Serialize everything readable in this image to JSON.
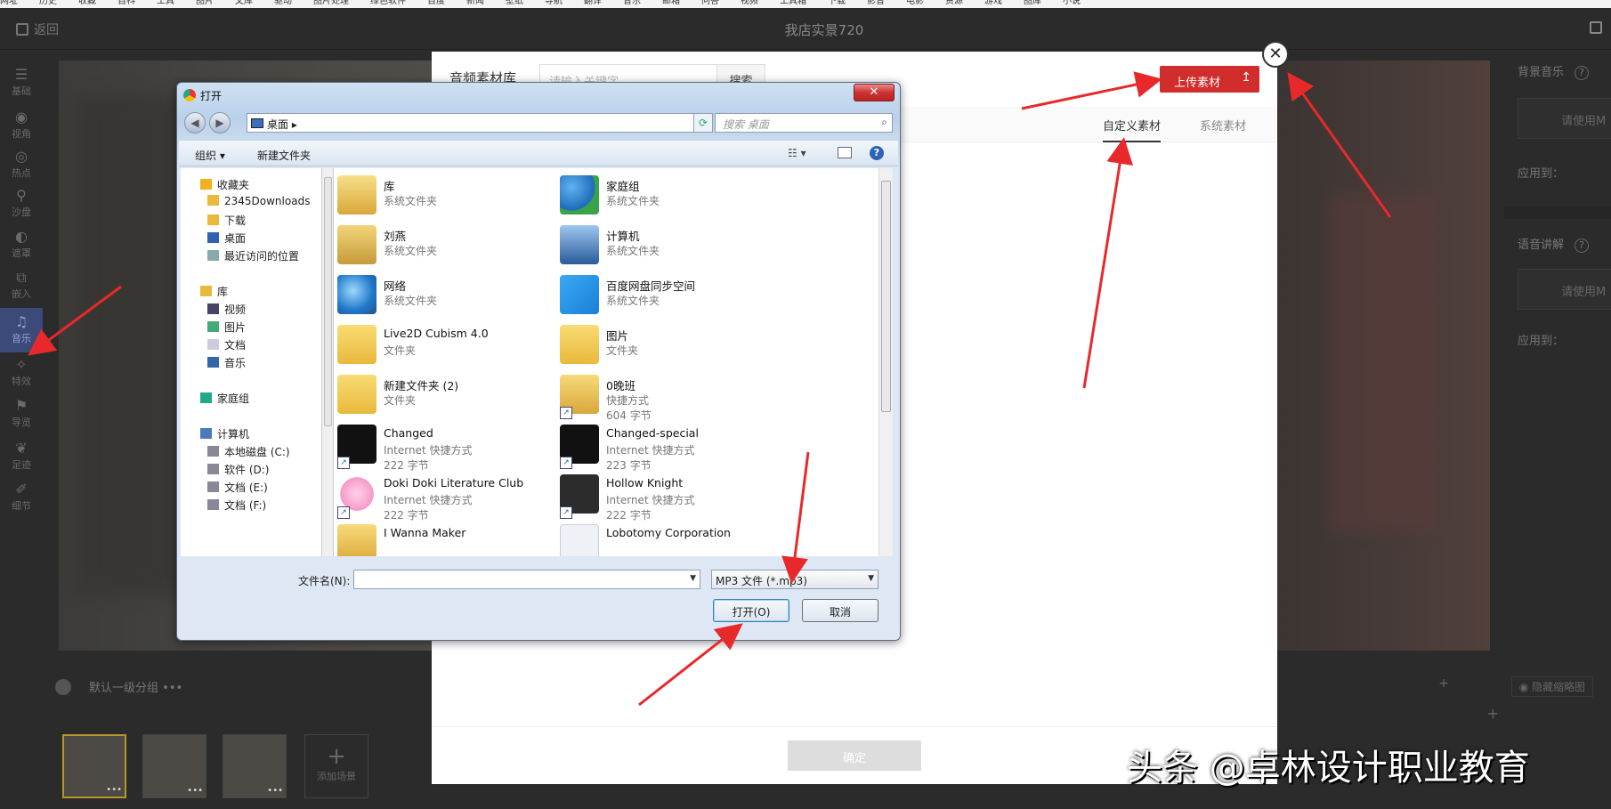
{
  "bookmarks": [
    "网址",
    "历史",
    "收藏",
    "百科",
    "工具",
    "图片",
    "文库",
    "驱动",
    "图片处理",
    "绿色软件",
    "百度",
    "新闻",
    "壁纸",
    "导航",
    "翻译",
    "音乐",
    "邮箱",
    "问答",
    "视频",
    "工具箱",
    "下载",
    "影音",
    "电影",
    "资源",
    "游戏",
    "图库",
    "小说"
  ],
  "app": {
    "back_label": "返回",
    "title": "我店实景720"
  },
  "rail": [
    {
      "icon": "list-icon",
      "glyph": "☰",
      "label": "基础"
    },
    {
      "icon": "eye-icon",
      "glyph": "◉",
      "label": "视角"
    },
    {
      "icon": "hotspot-icon",
      "glyph": "◎",
      "label": "热点"
    },
    {
      "icon": "pin-icon",
      "glyph": "⚲",
      "label": "沙盘"
    },
    {
      "icon": "mask-icon",
      "glyph": "◐",
      "label": "遮罩"
    },
    {
      "icon": "embed-icon",
      "glyph": "⧉",
      "label": "嵌入"
    },
    {
      "icon": "music-icon",
      "glyph": "♫",
      "label": "音乐"
    },
    {
      "icon": "effect-icon",
      "glyph": "✧",
      "label": "特效"
    },
    {
      "icon": "guide-icon",
      "glyph": "⚑",
      "label": "导览"
    },
    {
      "icon": "footprint-icon",
      "glyph": "❦",
      "label": "足迹"
    },
    {
      "icon": "detail-icon",
      "glyph": "✐",
      "label": "细节"
    }
  ],
  "right_panel": {
    "bg_music_title": "背景音乐",
    "bg_music_placeholder": "请使用M",
    "apply_to_1": "应用到：",
    "voice_title": "语音讲解",
    "voice_placeholder": "请使用M",
    "apply_to_2": "应用到：",
    "help_glyph": "?"
  },
  "bottom": {
    "group_label": "默认一级分组",
    "group_more": "•••",
    "add_scene_label": "添加场景",
    "hide_thumbs_label": "隐藏缩略图",
    "thumb_more": "•••"
  },
  "modal": {
    "title": "音频素材库",
    "search_placeholder": "请输入关键字",
    "search_button": "搜索",
    "upload_button": "上传素材",
    "tabs": [
      "自定义素材",
      "系统素材"
    ],
    "ok_button": "确定",
    "close_glyph": "✕"
  },
  "dialog": {
    "title": "打开",
    "address": "桌面",
    "address_arrow": "▸",
    "search_placeholder": "搜索 桌面",
    "toolbar": {
      "organize": "组织 ▾",
      "new_folder": "新建文件夹"
    },
    "nav": [
      {
        "label": "收藏夹",
        "level": 1,
        "icon": "star-icon",
        "color": "#f3b21b"
      },
      {
        "label": "2345Downloads",
        "level": 2,
        "icon": "folder-icon",
        "color": "#e8b93b"
      },
      {
        "label": "下载",
        "level": 2,
        "icon": "download-folder-icon",
        "color": "#e8b93b"
      },
      {
        "label": "桌面",
        "level": 2,
        "icon": "desktop-icon",
        "color": "#2f62b0"
      },
      {
        "label": "最近访问的位置",
        "level": 2,
        "icon": "recent-icon",
        "color": "#8aa"
      },
      {
        "label": "库",
        "level": 1,
        "icon": "library-icon",
        "color": "#e8b93b"
      },
      {
        "label": "视频",
        "level": 2,
        "icon": "video-icon",
        "color": "#446"
      },
      {
        "label": "图片",
        "level": 2,
        "icon": "pictures-icon",
        "color": "#4a7"
      },
      {
        "label": "文档",
        "level": 2,
        "icon": "document-icon",
        "color": "#ccd"
      },
      {
        "label": "音乐",
        "level": 2,
        "icon": "music-icon",
        "color": "#36a"
      },
      {
        "label": "家庭组",
        "level": 1,
        "icon": "homegroup-icon",
        "color": "#2a8"
      },
      {
        "label": "计算机",
        "level": 1,
        "icon": "computer-icon",
        "color": "#4a7bbf"
      },
      {
        "label": "本地磁盘 (C:)",
        "level": 2,
        "icon": "drive-icon",
        "color": "#889"
      },
      {
        "label": "软件 (D:)",
        "level": 2,
        "icon": "drive-icon",
        "color": "#889"
      },
      {
        "label": "文档 (E:)",
        "level": 2,
        "icon": "drive-icon",
        "color": "#889"
      },
      {
        "label": "文档 (F:)",
        "level": 2,
        "icon": "drive-icon",
        "color": "#889"
      }
    ],
    "files": [
      {
        "name": "库",
        "l1": "系统文件夹",
        "l2": "",
        "icon": "lib",
        "shortcut": false
      },
      {
        "name": "家庭组",
        "l1": "系统文件夹",
        "l2": "",
        "icon": "home",
        "shortcut": false
      },
      {
        "name": "刘燕",
        "l1": "系统文件夹",
        "l2": "",
        "icon": "user",
        "shortcut": false
      },
      {
        "name": "计算机",
        "l1": "系统文件夹",
        "l2": "",
        "icon": "comp",
        "shortcut": false
      },
      {
        "name": "网络",
        "l1": "系统文件夹",
        "l2": "",
        "icon": "net",
        "shortcut": false
      },
      {
        "name": "百度网盘同步空间",
        "l1": "系统文件夹",
        "l2": "",
        "icon": "baidu",
        "shortcut": false
      },
      {
        "name": "Live2D Cubism 4.0",
        "l1": "文件夹",
        "l2": "",
        "icon": "folder",
        "shortcut": false
      },
      {
        "name": "图片",
        "l1": "文件夹",
        "l2": "",
        "icon": "folder",
        "shortcut": false
      },
      {
        "name": "新建文件夹 (2)",
        "l1": "文件夹",
        "l2": "",
        "icon": "folder",
        "shortcut": false
      },
      {
        "name": "0晚班",
        "l1": "快捷方式",
        "l2": "604 字节",
        "icon": "wm",
        "shortcut": true
      },
      {
        "name": "Changed",
        "l1": "Internet 快捷方式",
        "l2": "222 字节",
        "icon": "black",
        "shortcut": true
      },
      {
        "name": "Changed-special",
        "l1": "Internet 快捷方式",
        "l2": "223 字节",
        "icon": "black",
        "shortcut": true
      },
      {
        "name": "Doki Doki Literature Club",
        "l1": "Internet 快捷方式",
        "l2": "222 字节",
        "icon": "doki",
        "shortcut": true
      },
      {
        "name": "Hollow Knight",
        "l1": "Internet 快捷方式",
        "l2": "222 字节",
        "icon": "hk",
        "shortcut": true
      },
      {
        "name": "I Wanna Maker",
        "l1": "",
        "l2": "",
        "icon": "wm",
        "shortcut": false
      },
      {
        "name": "Lobotomy Corporation",
        "l1": "",
        "l2": "",
        "icon": "doc",
        "shortcut": false
      }
    ],
    "filename_label": "文件名(N):",
    "filename_value": "",
    "filetype": "MP3 文件 (*.mp3)",
    "open_button": "打开(O)",
    "cancel_button": "取消",
    "shortcut_glyph": "↗",
    "help_glyph": "?",
    "view_glyph": "☷ ▾",
    "close_glyph": "✕",
    "dropdown_glyph": "▼",
    "back_glyph": "◀",
    "forward_glyph": "▶",
    "refresh_glyph": "⟳",
    "search_glyph": "⌕"
  },
  "watermark": "头条 @卓林设计职业教育",
  "colors": {
    "accent_red": "#d12d2d",
    "arrow_red": "#e8292b",
    "rail_active": "#3b4a78"
  }
}
